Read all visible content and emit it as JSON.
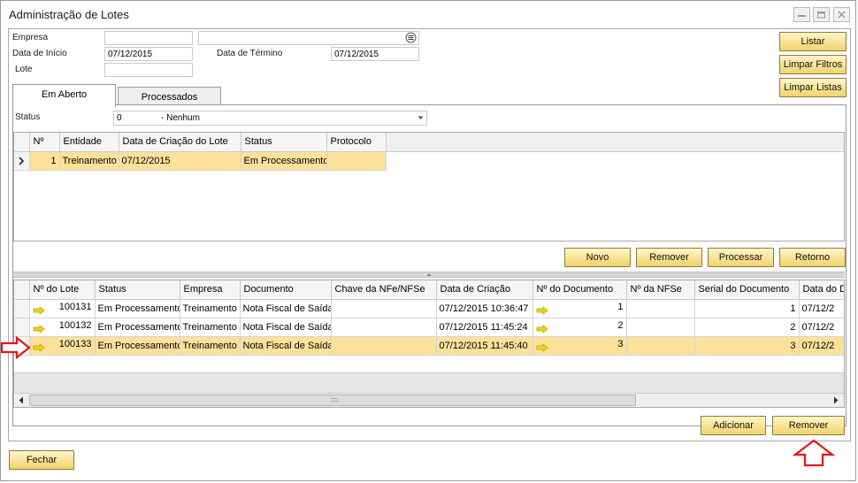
{
  "window": {
    "title": "Administração de Lotes"
  },
  "filters": {
    "empresa_label": "Empresa",
    "empresa_code": "",
    "empresa_name": "",
    "data_inicio_label": "Data de Início",
    "data_inicio_value": "07/12/2015",
    "data_termino_label": "Data de Término",
    "data_termino_value": "07/12/2015",
    "lote_label": "Lote",
    "lote_value": ""
  },
  "side_buttons": {
    "listar": "Listar",
    "limpar_filtros": "Limpar Filtros",
    "limpar_listas": "Limpar Listas"
  },
  "tabs": [
    {
      "label": "Em Aberto",
      "active": true
    },
    {
      "label": "Processados",
      "active": false
    }
  ],
  "status": {
    "label": "Status",
    "code": "0",
    "value": "- Nenhum"
  },
  "batch_grid": {
    "headers": [
      "Nº",
      "Entidade",
      "Data de Criação do Lote",
      "Status",
      "Protocolo"
    ],
    "rows": [
      {
        "n": "1",
        "entidade": "Treinamento",
        "data": "07/12/2015",
        "status": "Em Processamento",
        "protocolo": ""
      }
    ]
  },
  "batch_buttons": {
    "novo": "Novo",
    "remover": "Remover",
    "processar": "Processar",
    "retorno": "Retorno"
  },
  "doc_grid": {
    "headers": [
      "Nº do Lote",
      "Status",
      "Empresa",
      "Documento",
      "Chave da NFe/NFSe",
      "Data de Criação",
      "Nº do Documento",
      "Nº da NFSe",
      "Serial do Documento",
      "Data do D"
    ],
    "rows": [
      {
        "lote": "100131",
        "status": "Em Processamento",
        "empresa": "Treinamento",
        "documento": "Nota Fiscal de Saída",
        "chave": "",
        "data": "07/12/2015 10:36:47",
        "ndoc": "1",
        "nfse": "",
        "serial": "1",
        "datad": "07/12/2"
      },
      {
        "lote": "100132",
        "status": "Em Processamento",
        "empresa": "Treinamento",
        "documento": "Nota Fiscal de Saída",
        "chave": "",
        "data": "07/12/2015 11:45:24",
        "ndoc": "2",
        "nfse": "",
        "serial": "2",
        "datad": "07/12/2"
      },
      {
        "lote": "100133",
        "status": "Em Processamento",
        "empresa": "Treinamento",
        "documento": "Nota Fiscal de Saída",
        "chave": "",
        "data": "07/12/2015 11:45:40",
        "ndoc": "3",
        "nfse": "",
        "serial": "3",
        "datad": "07/12/2"
      }
    ]
  },
  "doc_buttons": {
    "adicionar": "Adicionar",
    "remover": "Remover"
  },
  "footer": {
    "fechar": "Fechar"
  },
  "colors": {
    "button_top": "#fff6c8",
    "button_bottom": "#f2d36a",
    "selected_row": "#fbe19a",
    "annotation_arrow": "#e8141b",
    "link_arrow": "#f5d210"
  },
  "icons": {
    "link_arrow": "arrow-right-icon",
    "row_indicator": "chevron-right-icon",
    "annotation": "red-outline-arrow-icon"
  }
}
